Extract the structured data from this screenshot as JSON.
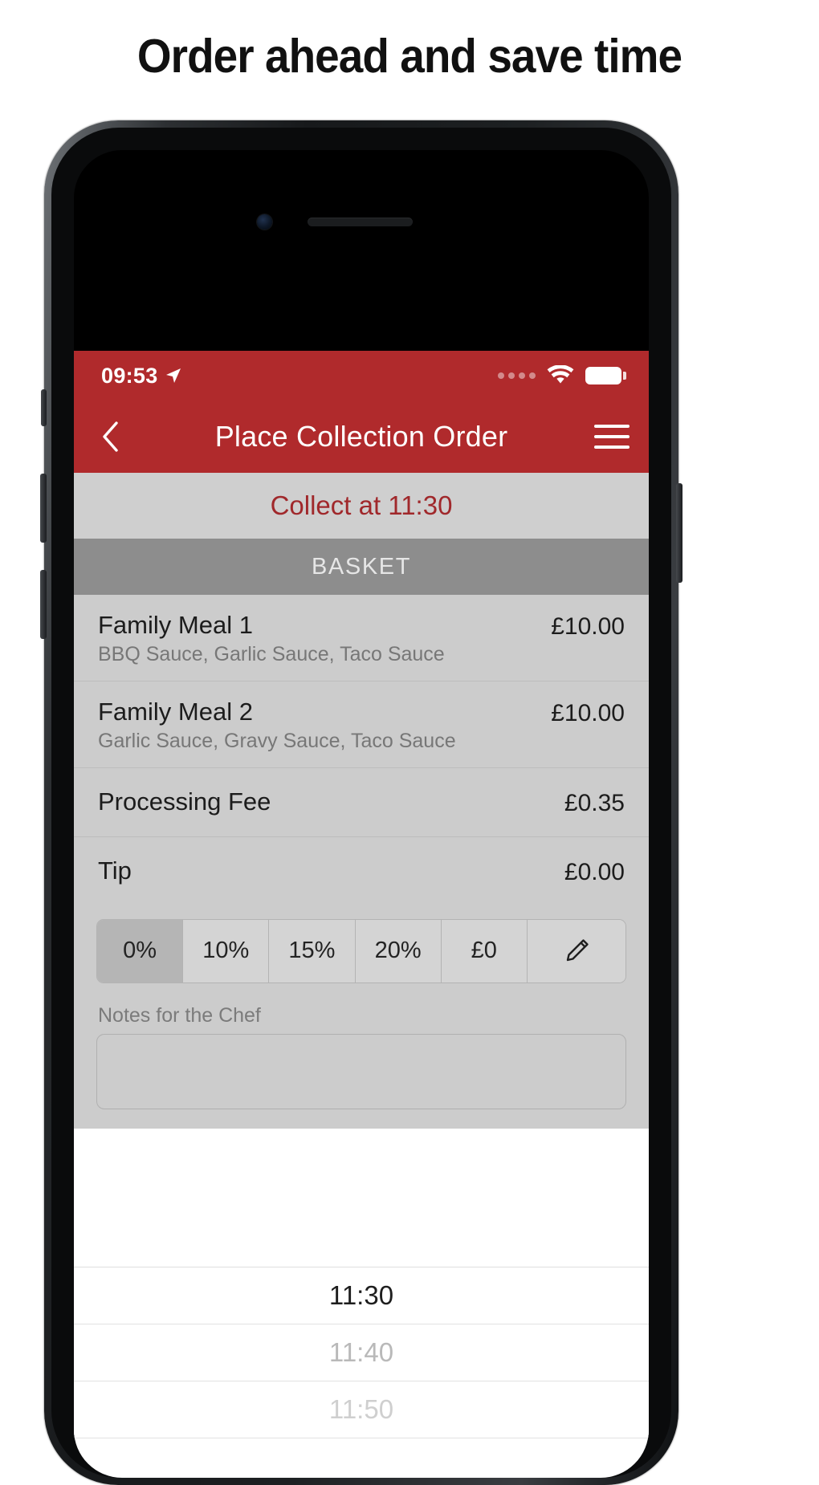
{
  "marketing": {
    "headline": "Order ahead and save time"
  },
  "device": {
    "earpiece_icon": "speaker-grille",
    "camera_icon": "front-camera"
  },
  "app": {
    "status_bar": {
      "time": "09:53",
      "location_icon": "location-arrow-icon",
      "signal_icon": "signal-dots-icon",
      "wifi_icon": "wifi-icon",
      "battery_icon": "battery-full-icon"
    },
    "nav": {
      "back_icon": "chevron-left-icon",
      "title": "Place Collection Order",
      "menu_icon": "hamburger-menu-icon"
    },
    "collect": {
      "label": "Collect at 11:30"
    },
    "basket": {
      "header": "BASKET",
      "items": [
        {
          "name": "Family Meal 1",
          "options": "BBQ Sauce, Garlic Sauce, Taco Sauce",
          "price": "£10.00"
        },
        {
          "name": "Family Meal 2",
          "options": "Garlic Sauce, Gravy Sauce, Taco Sauce",
          "price": "£10.00"
        }
      ],
      "fees": [
        {
          "name": "Processing Fee",
          "price": "£0.35"
        },
        {
          "name": "Tip",
          "price": "£0.00"
        }
      ]
    },
    "tip": {
      "options": [
        "0%",
        "10%",
        "15%",
        "20%",
        "£0"
      ],
      "selected": "0%",
      "edit_icon": "pencil-icon"
    },
    "notes": {
      "label": "Notes for the Chef",
      "value": "",
      "placeholder": ""
    },
    "time_picker": {
      "rows": [
        {
          "label": "11:30",
          "state": "active"
        },
        {
          "label": "11:40",
          "state": "dim"
        },
        {
          "label": "11:50",
          "state": "dimmer"
        }
      ]
    }
  },
  "colors": {
    "brand_red": "#b02a2c",
    "collect_red": "#a0282b",
    "basket_bg": "#cccccc",
    "basket_header_bg": "#8d8d8d",
    "collect_bar_bg": "#cfcfcf"
  }
}
